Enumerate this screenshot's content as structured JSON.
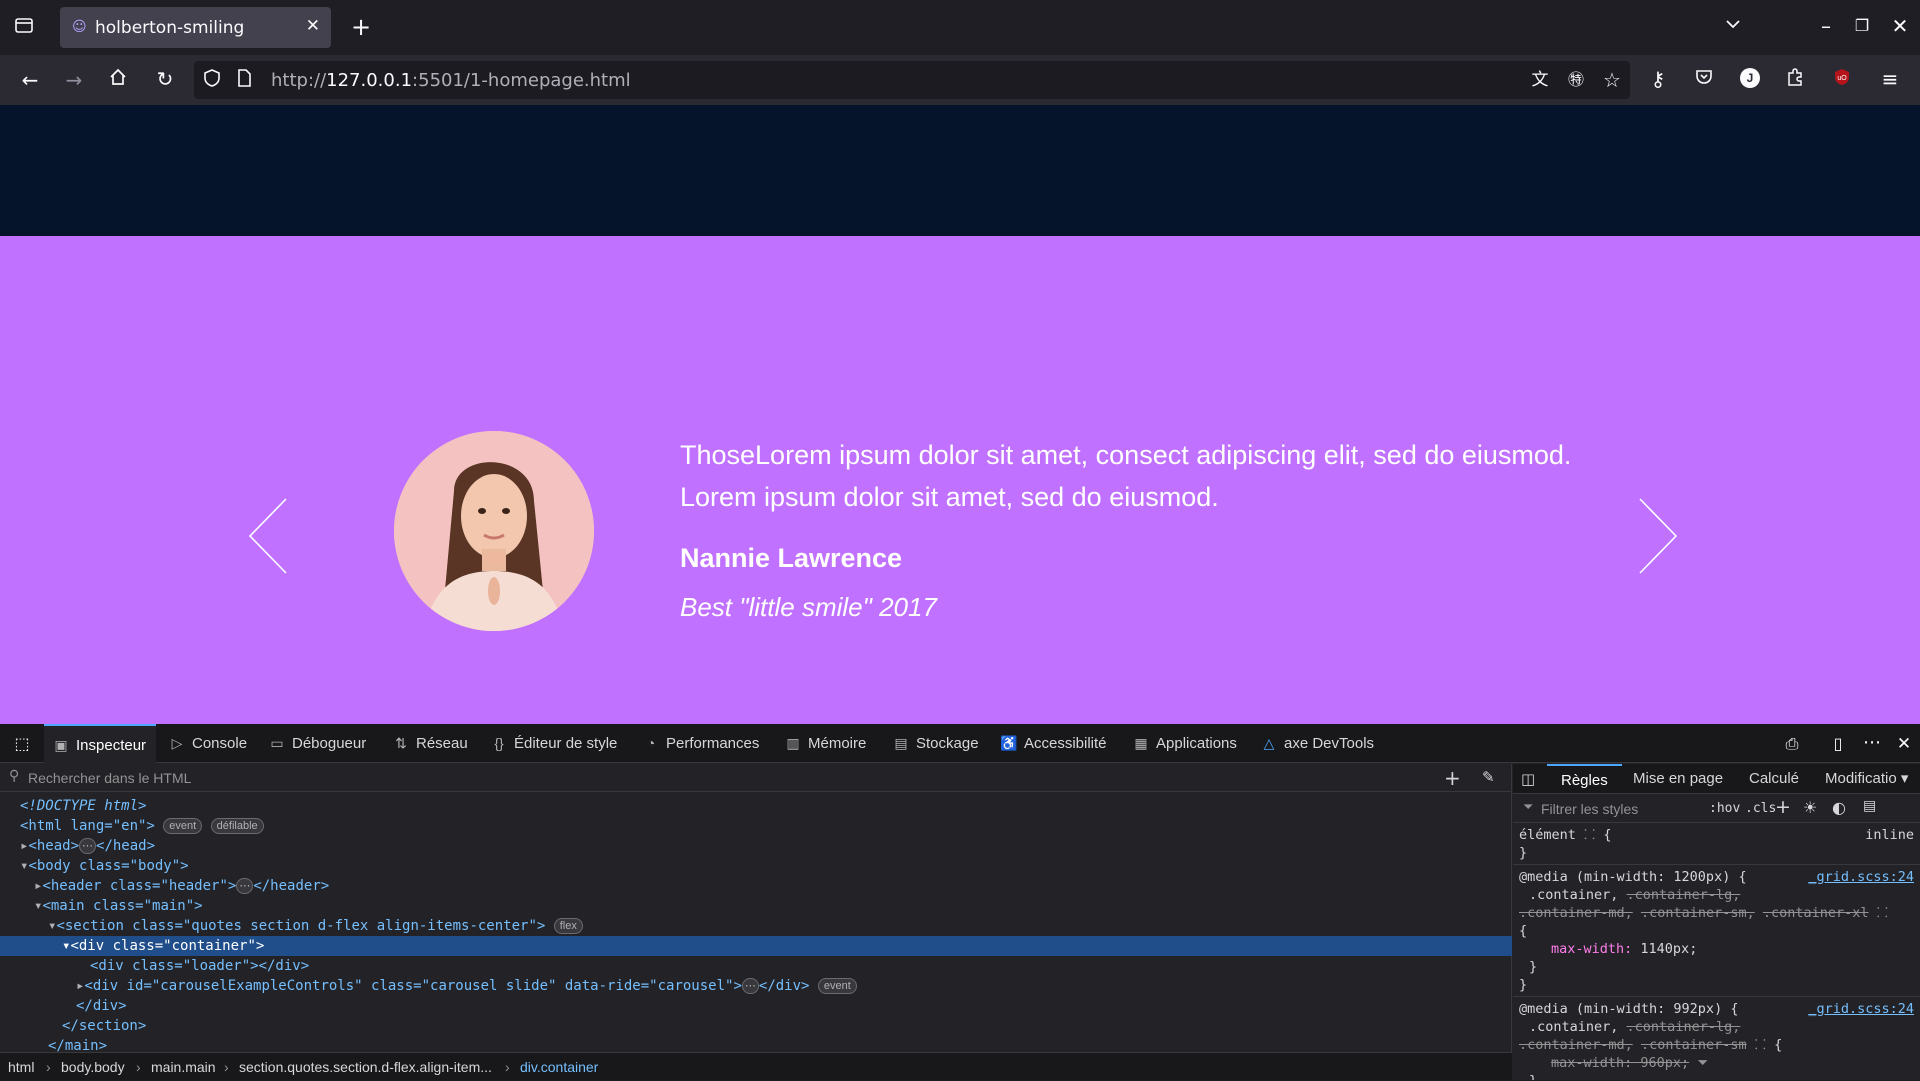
{
  "browser": {
    "tab_title": "holberton-smiling",
    "url_prefix": "http://",
    "url_host": "127.0.0.1",
    "url_rest": ":5501/1-homepage.html"
  },
  "page": {
    "quote_text": "ThoseLorem ipsum dolor sit amet, consect adipiscing elit, sed do eiusmod. Lorem ipsum dolor sit amet, sed do eiusmod.",
    "quote_name": "Nannie Lawrence",
    "quote_caption": "Best \"little smile\" 2017",
    "colors": {
      "header_bg": "#05142a",
      "quotes_bg": "#c171ff"
    }
  },
  "devtools": {
    "tabs": [
      "Inspecteur",
      "Console",
      "Débogueur",
      "Réseau",
      "Éditeur de style",
      "Performances",
      "Mémoire",
      "Stockage",
      "Accessibilité",
      "Applications",
      "axe DevTools"
    ],
    "html_search_placeholder": "Rechercher dans le HTML",
    "tree": {
      "doctype": "<!DOCTYPE html>",
      "html_open": "<html lang=\"en\">",
      "pill_event": "event",
      "pill_scroll": "défilable",
      "pill_flex": "flex",
      "head": "<head>",
      "head_close": "</head>",
      "body_open": "<body class=\"body\">",
      "header_open": "<header class=\"header\">",
      "header_close": "</header>",
      "main_open": "<main class=\"main\">",
      "section_open": "<section class=\"quotes section d-flex align-items-center\">",
      "container_open": "<div class=\"container\">",
      "loader": "<div class=\"loader\"></div>",
      "carousel_open": "<div id=\"carouselExampleControls\" class=\"carousel slide\" data-ride=\"carousel\">",
      "div_close": "</div>",
      "section_close": "</section>",
      "main_close": "</main>"
    },
    "breadcrumb": [
      "html",
      "body.body",
      "main.main",
      "section.quotes.section.d-flex.align-item...",
      "div.container"
    ],
    "rules_tabs": [
      "Règles",
      "Mise en page",
      "Calculé",
      "Modificatio"
    ],
    "rules_filter_placeholder": "Filtrer les styles",
    "rules_hov": ":hov",
    "rules_cls": ".cls",
    "rules": {
      "element": "élément",
      "element_open": "{",
      "inline": "inline",
      "close": "}",
      "media1": "@media (min-width: 1200px) {",
      "media1_src": "_grid.scss:24",
      "sel1": ".container,",
      "sel1_s1": ".container-lg,",
      "sel1_s2": ".container-md,",
      "sel1_s3": ".container-sm,",
      "sel1_s4": ".container-xl",
      "open": "{",
      "prop1": "max-width:",
      "val1": "1140px;",
      "media2": "@media (min-width: 992px) {",
      "media2_src": "_grid.scss:24",
      "sel2": ".container,",
      "sel2_s1": ".container-lg,",
      "sel2_s2": ".container-md,",
      "sel2_s3": ".container-sm",
      "prop2": "max-width: 960px;"
    }
  }
}
